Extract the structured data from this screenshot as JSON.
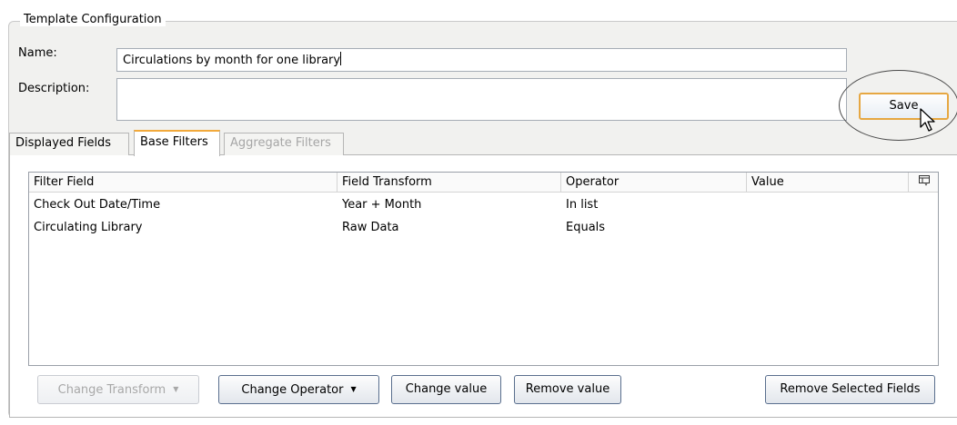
{
  "config": {
    "legend": "Template Configuration",
    "name_label": "Name:",
    "name_value": "Circulations by month for one library",
    "description_label": "Description:",
    "description_value": "",
    "save_label": "Save"
  },
  "tabs": [
    {
      "label": "Displayed Fields",
      "state": "normal"
    },
    {
      "label": "Base Filters",
      "state": "active"
    },
    {
      "label": "Aggregate Filters",
      "state": "disabled"
    }
  ],
  "grid": {
    "columns": [
      "Filter Field",
      "Field Transform",
      "Operator",
      "Value"
    ],
    "column_picker_icon": "column-picker-icon",
    "rows": [
      [
        "Check Out Date/Time",
        "Year + Month",
        "In list",
        ""
      ],
      [
        "Circulating Library",
        "Raw Data",
        "Equals",
        ""
      ]
    ]
  },
  "actions": {
    "change_transform": "Change Transform",
    "change_operator": "Change Operator",
    "change_value": "Change value",
    "remove_value": "Remove value",
    "remove_selected": "Remove Selected Fields"
  },
  "colors": {
    "active_tab_accent": "#f2a93b",
    "save_button_border": "#e6a742",
    "button_border": "#5a6f8e"
  }
}
